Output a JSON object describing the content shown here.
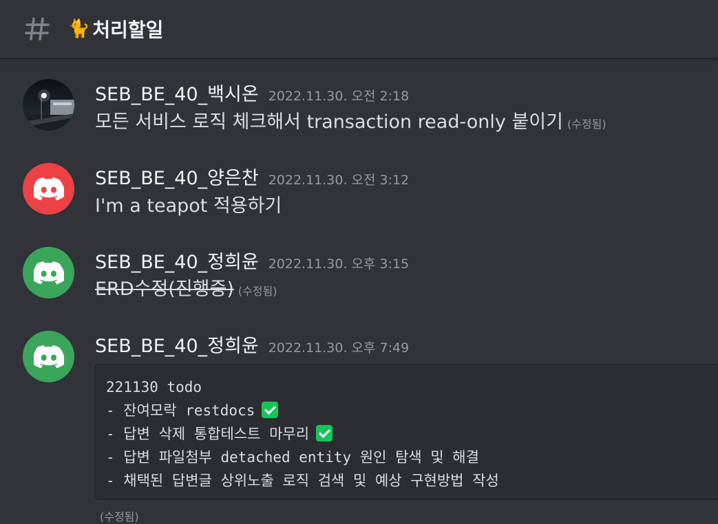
{
  "channel": {
    "emoji": "🐈",
    "name": "처리할일"
  },
  "messages": [
    {
      "username": "SEB_BE_40_백시온",
      "timestamp": "2022.11.30. 오전 2:18",
      "text": "모든 서비스 로직 체크해서 transaction read-only 붙이기",
      "edited": "(수정됨)"
    },
    {
      "username": "SEB_BE_40_양은찬",
      "timestamp": "2022.11.30. 오전 3:12",
      "text": "I'm a teapot 적용하기"
    },
    {
      "username": "SEB_BE_40_정희윤",
      "timestamp": "2022.11.30. 오후 3:15",
      "text": "ERD수정(진행중)",
      "edited": "(수정됨)"
    },
    {
      "username": "SEB_BE_40_정희윤",
      "timestamp": "2022.11.30. 오후 7:49",
      "code_lines": [
        "221130 todo",
        "- 잔여모락 restdocs",
        "- 답변 삭제 통합테스트 마무리",
        "- 답변 파일첨부 detached entity 원인 탐색 및 해결",
        "- 채택된 답변글 상위노출 로직 검색 및 예상 구현방법 작성"
      ],
      "edited": "(수정됨)"
    }
  ],
  "colors": {
    "background": "#313338",
    "discord_red": "#ed4245",
    "discord_green": "#3ba55c",
    "check_green": "#16c55a"
  },
  "icons": {
    "channel": "hash-icon",
    "discord_avatar": "discord-logo-icon",
    "check": "check-mark-icon"
  }
}
